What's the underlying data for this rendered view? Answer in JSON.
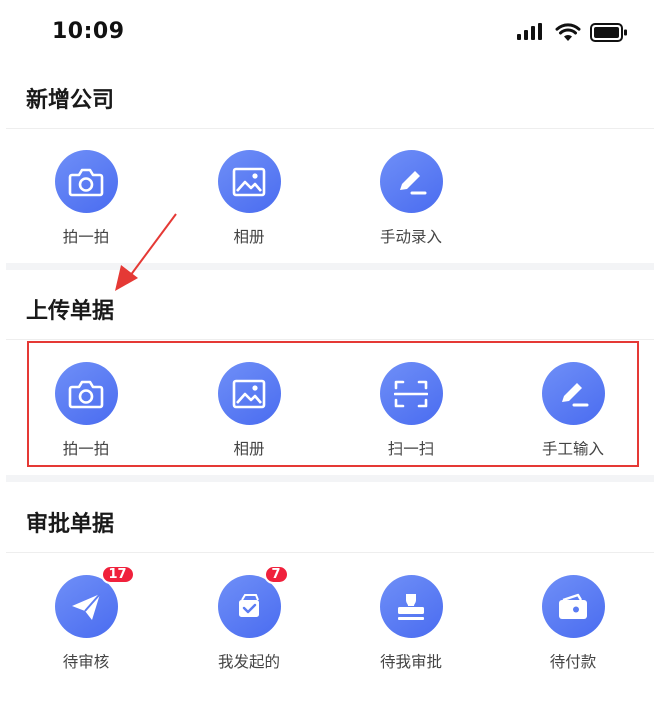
{
  "status_bar": {
    "time": "10:09"
  },
  "sections": [
    {
      "title": "新增公司",
      "items": [
        {
          "label": "拍一拍",
          "icon": "camera-icon"
        },
        {
          "label": "相册",
          "icon": "image-icon"
        },
        {
          "label": "手动录入",
          "icon": "pencil-icon"
        }
      ]
    },
    {
      "title": "上传单据",
      "items": [
        {
          "label": "拍一拍",
          "icon": "camera-icon"
        },
        {
          "label": "相册",
          "icon": "image-icon"
        },
        {
          "label": "扫一扫",
          "icon": "scan-icon"
        },
        {
          "label": "手工输入",
          "icon": "pencil-icon"
        }
      ]
    },
    {
      "title": "审批单据",
      "items": [
        {
          "label": "待审核",
          "icon": "paper-plane-icon",
          "badge": "17"
        },
        {
          "label": "我发起的",
          "icon": "document-check-icon",
          "badge": "7"
        },
        {
          "label": "待我审批",
          "icon": "stamp-icon"
        },
        {
          "label": "待付款",
          "icon": "wallet-icon"
        }
      ]
    }
  ],
  "colors": {
    "icon_circle": "#5b7cf3",
    "badge": "#f0213c",
    "highlight": "#e53935"
  }
}
